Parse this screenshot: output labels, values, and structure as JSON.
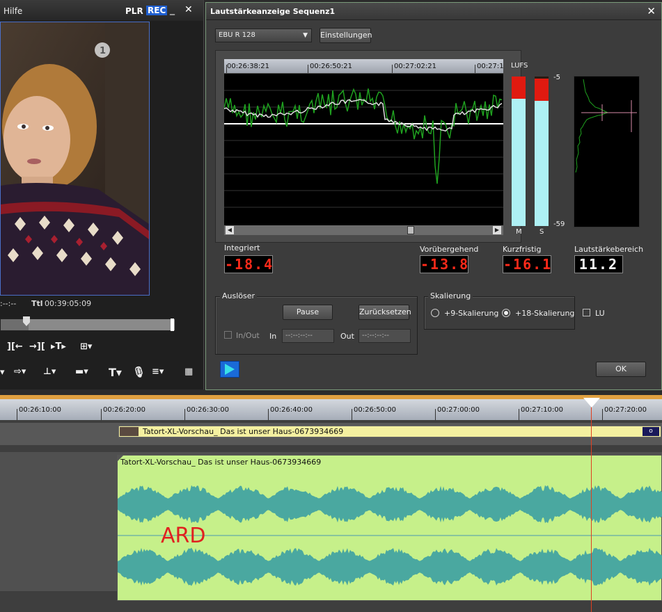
{
  "player": {
    "menu_label": "Hilfe",
    "plr": "PLR",
    "rec": "REC",
    "minimize": "_",
    "close": "✕",
    "timecode_left": ":--:--",
    "ttl_label": "Ttl",
    "ttl_value": "00:39:05:09",
    "video_logo": "1"
  },
  "dialog": {
    "title": "Lautstärkeanzeige  Sequenz1",
    "close": "✕",
    "preset": "EBU R 128",
    "settings_button": "Einstellungen",
    "ruler_labels": [
      "00:26:38:21",
      "00:26:50:21",
      "00:27:02:21",
      "00:27:1"
    ],
    "lufs_label": "LUFS",
    "scale_top": "-5",
    "scale_bottom": "-59",
    "meter_m": "M",
    "meter_s": "S",
    "integrated_label": "Integriert",
    "integrated_value": "-18.4",
    "momentary_label": "Vorübergehend",
    "momentary_value": "-13.8",
    "shortterm_label": "Kurzfristig",
    "shortterm_value": "-16.1",
    "lra_label": "Lautstärkebereich",
    "lra_value": "11.2",
    "trigger_group": "Auslöser",
    "pause_button": "Pause",
    "reset_button": "Zurücksetzen",
    "inout_label": "In/Out",
    "in_label": "In",
    "in_value": "--:--:--:--",
    "out_label": "Out",
    "out_value": "--:--:--:--",
    "scaling_group": "Skalierung",
    "scale9_label": "+9-Skalierung",
    "scale18_label": "+18-Skalierung",
    "lu_label": "LU",
    "ok_button": "OK",
    "meter_m_level": -11.8,
    "meter_s_level": -13.8
  },
  "timeline": {
    "ruler_labels": [
      "00:26:10:00",
      "00:26:20:00",
      "00:26:30:00",
      "00:26:40:00",
      "00:26:50:00",
      "00:27:00:00",
      "00:27:10:00",
      "00:27:20:00"
    ],
    "video_clip_title": "Tatort-XL-Vorschau_ Das ist unser Haus-0673934669",
    "audio_clip_title": "Tatort-XL-Vorschau_ Das ist unser Haus-0673934669",
    "overlay_text": "ARD"
  },
  "colors": {
    "meter_fill": "#aef0f4",
    "meter_red": "#e01a10",
    "value_red": "#ff2a1a",
    "audio_clip": "#c6f08a",
    "waveform": "#4aa8a0",
    "graph_green": "#1fa01f"
  }
}
